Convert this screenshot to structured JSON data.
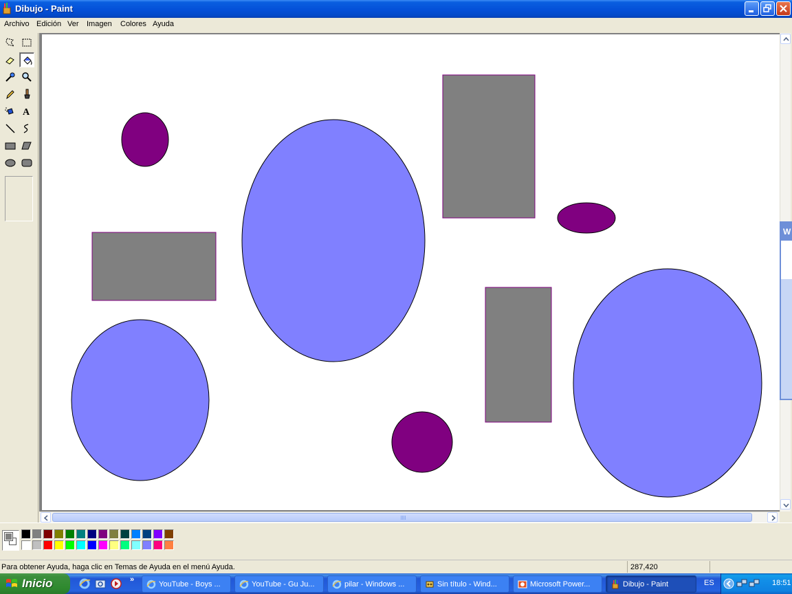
{
  "window": {
    "title": "Dibujo - Paint"
  },
  "menu": [
    "Archivo",
    "Edición",
    "Ver",
    "Imagen",
    "Colores",
    "Ayuda"
  ],
  "tools": [
    {
      "name": "free-form-select-icon"
    },
    {
      "name": "rect-select-icon"
    },
    {
      "name": "eraser-icon"
    },
    {
      "name": "fill-bucket-icon",
      "selected": true
    },
    {
      "name": "color-picker-icon"
    },
    {
      "name": "magnifier-icon"
    },
    {
      "name": "pencil-icon"
    },
    {
      "name": "brush-icon"
    },
    {
      "name": "airbrush-icon"
    },
    {
      "name": "text-icon",
      "glyph": "A"
    },
    {
      "name": "line-icon"
    },
    {
      "name": "curve-icon"
    },
    {
      "name": "rectangle-icon"
    },
    {
      "name": "polygon-icon"
    },
    {
      "name": "ellipse-icon"
    },
    {
      "name": "rounded-rect-icon"
    }
  ],
  "palette": {
    "foreground": "#808080",
    "background": "#ffffff",
    "top_row": [
      "#000000",
      "#808080",
      "#800000",
      "#808000",
      "#008000",
      "#008080",
      "#000080",
      "#800080",
      "#808040",
      "#004040",
      "#0080ff",
      "#004080",
      "#8000ff",
      "#804000"
    ],
    "bottom_row": [
      "#ffffff",
      "#c0c0c0",
      "#ff0000",
      "#ffff00",
      "#00ff00",
      "#00ffff",
      "#0000ff",
      "#ff00ff",
      "#ffff80",
      "#00ff80",
      "#80ffff",
      "#8080ff",
      "#ff0080",
      "#ff8040"
    ]
  },
  "shape_colors": {
    "blue": "#8080ff",
    "purple": "#800080",
    "gray": "#808080",
    "rect_border": "#800080",
    "ellipse_border": "#000000"
  },
  "status": {
    "help_text": "Para obtener Ayuda, haga clic en Temas de Ayuda en el menú Ayuda.",
    "coords": "287,420"
  },
  "side_widget": {
    "label": "W"
  },
  "taskbar": {
    "start_label": "Inicio",
    "quick_launch_more": "»",
    "tasks": [
      {
        "label": "YouTube - Boys ...",
        "icon": "ie-icon",
        "active": false
      },
      {
        "label": "YouTube - Gu Ju...",
        "icon": "ie-icon",
        "active": false
      },
      {
        "label": "pilar - Windows ...",
        "icon": "ie-icon",
        "active": false
      },
      {
        "label": "Sin título - Wind...",
        "icon": "movie-maker-icon",
        "active": false
      },
      {
        "label": "Microsoft Power...",
        "icon": "powerpoint-icon",
        "active": false
      },
      {
        "label": "Dibujo - Paint",
        "icon": "paint-icon",
        "active": true
      }
    ],
    "language": "ES",
    "clock": "18:51"
  }
}
